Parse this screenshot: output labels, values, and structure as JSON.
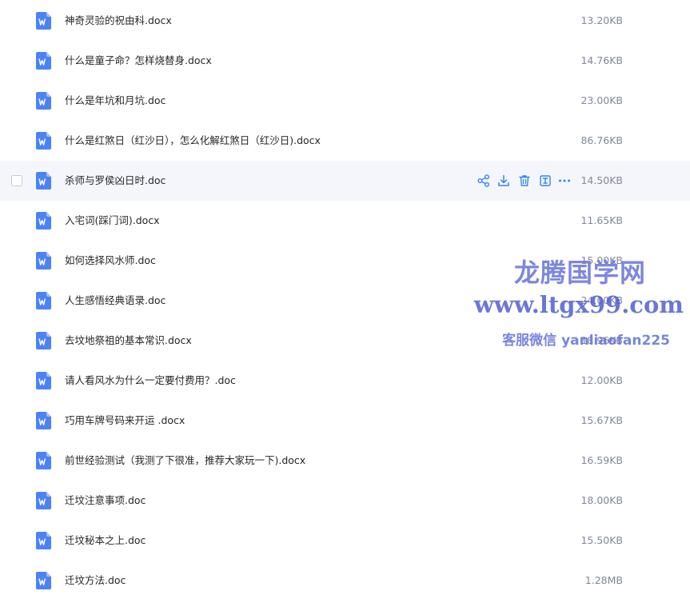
{
  "files": [
    {
      "name": "神奇灵验的祝由科.docx",
      "size": "13.20KB"
    },
    {
      "name": "什么是童子命？怎样烧替身.docx",
      "size": "14.76KB"
    },
    {
      "name": "什么是年坑和月坑.doc",
      "size": "23.00KB"
    },
    {
      "name": "什么是红煞日（红沙日），怎么化解红煞日（红沙日).docx",
      "size": "86.76KB"
    },
    {
      "name": "杀师与罗侯凶日时.doc",
      "size": "14.50KB"
    },
    {
      "name": "入宅词(踩门词).docx",
      "size": "11.65KB"
    },
    {
      "name": "如何选择风水师.doc",
      "size": "15.00KB"
    },
    {
      "name": "人生感悟经典语录.doc",
      "size": "24.00KB"
    },
    {
      "name": "去坟地祭祖的基本常识.docx",
      "size": "18.96KB"
    },
    {
      "name": "请人看风水为什么一定要付费用？.doc",
      "size": "12.00KB"
    },
    {
      "name": "巧用车牌号码来开运 .docx",
      "size": "15.67KB"
    },
    {
      "name": "前世经验测试（我测了下很准，推荐大家玩一下).docx",
      "size": "16.59KB"
    },
    {
      "name": "迁坟注意事项.doc",
      "size": "18.00KB"
    },
    {
      "name": "迁坟秘本之上.doc",
      "size": "15.50KB"
    },
    {
      "name": "迁坟方法.doc",
      "size": "1.28MB"
    }
  ],
  "hover_actions": [
    {
      "icon": "share-icon"
    },
    {
      "icon": "download-icon"
    },
    {
      "icon": "delete-icon"
    },
    {
      "icon": "rename-icon"
    },
    {
      "icon": "more-icon"
    }
  ],
  "watermark": {
    "title": "龙腾国学网",
    "url": "www.ltgx99.com",
    "contact": "客服微信 yanliaofan225"
  },
  "colors": {
    "doc_icon": "#4a83f7",
    "action_icon": "#2f86f6",
    "hover_row": "#f5f6fb",
    "size_text": "#818999",
    "watermark": "#5c6bd8"
  }
}
